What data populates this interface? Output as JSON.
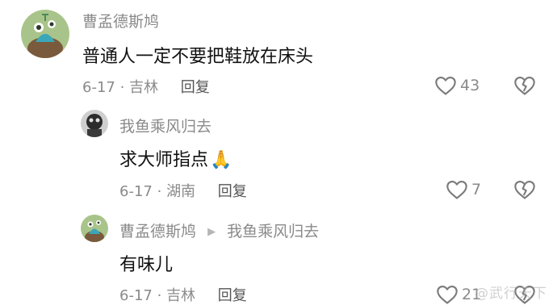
{
  "comments": [
    {
      "username": "曹孟德斯鸠",
      "content": "普通人一定不要把鞋放在床头",
      "date": "6-17",
      "location": "吉林",
      "reply_label": "回复",
      "likes": "43"
    },
    {
      "username": "我鱼乘风归去",
      "content": "求大师指点",
      "emoji": "🙏",
      "date": "6-17",
      "location": "湖南",
      "reply_label": "回复",
      "likes": "7"
    },
    {
      "username": "曹孟德斯鸠",
      "reply_to": "我鱼乘风归去",
      "content": "有味儿",
      "date": "6-17",
      "location": "吉林",
      "reply_label": "回复",
      "likes": "21"
    }
  ],
  "separator": "·",
  "watermark": "@武行天下",
  "colors": {
    "username": "#8a8a8a",
    "content": "#111111",
    "meta": "#8a8a8a",
    "icon_stroke": "#7a7a7a"
  },
  "icons": {
    "like": "heart-outline-icon",
    "dislike": "broken-heart-icon",
    "reply_arrow": "caret-right-icon"
  }
}
